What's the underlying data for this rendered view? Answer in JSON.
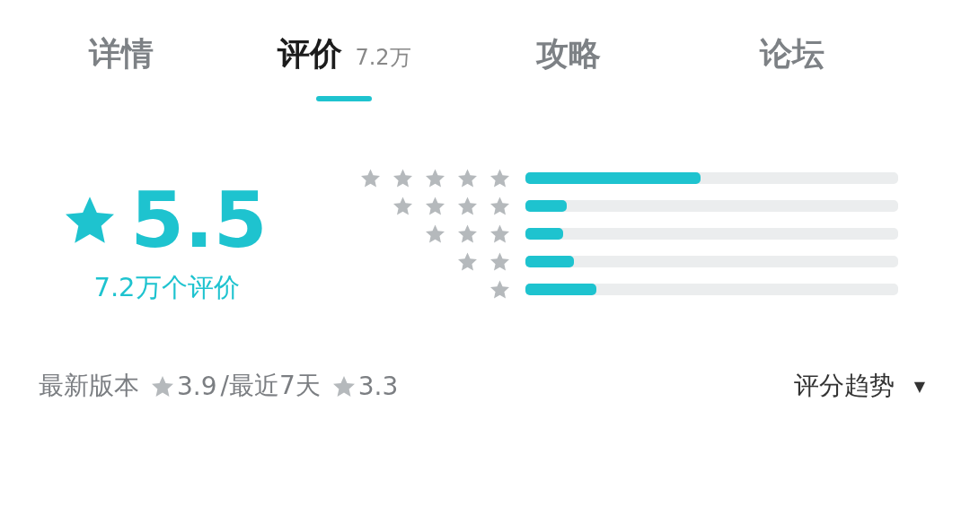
{
  "tabs": [
    {
      "label": "详情",
      "selected": false
    },
    {
      "label": "评价",
      "count": "7.2万",
      "selected": true
    },
    {
      "label": "攻略",
      "selected": false
    },
    {
      "label": "论坛",
      "selected": false
    }
  ],
  "score": {
    "value": "5.5",
    "count_label": "7.2万个评价"
  },
  "distribution": [
    {
      "level": 0.47
    },
    {
      "level": 0.11
    },
    {
      "level": 0.1
    },
    {
      "level": 0.13
    },
    {
      "level": 0.19
    }
  ],
  "summary": {
    "latest_label": "最新版本",
    "latest_score": "3.9",
    "recent_label": "/最近7天",
    "recent_score": "3.3",
    "trend_label": "评分趋势",
    "trend_caret": "▼"
  }
}
